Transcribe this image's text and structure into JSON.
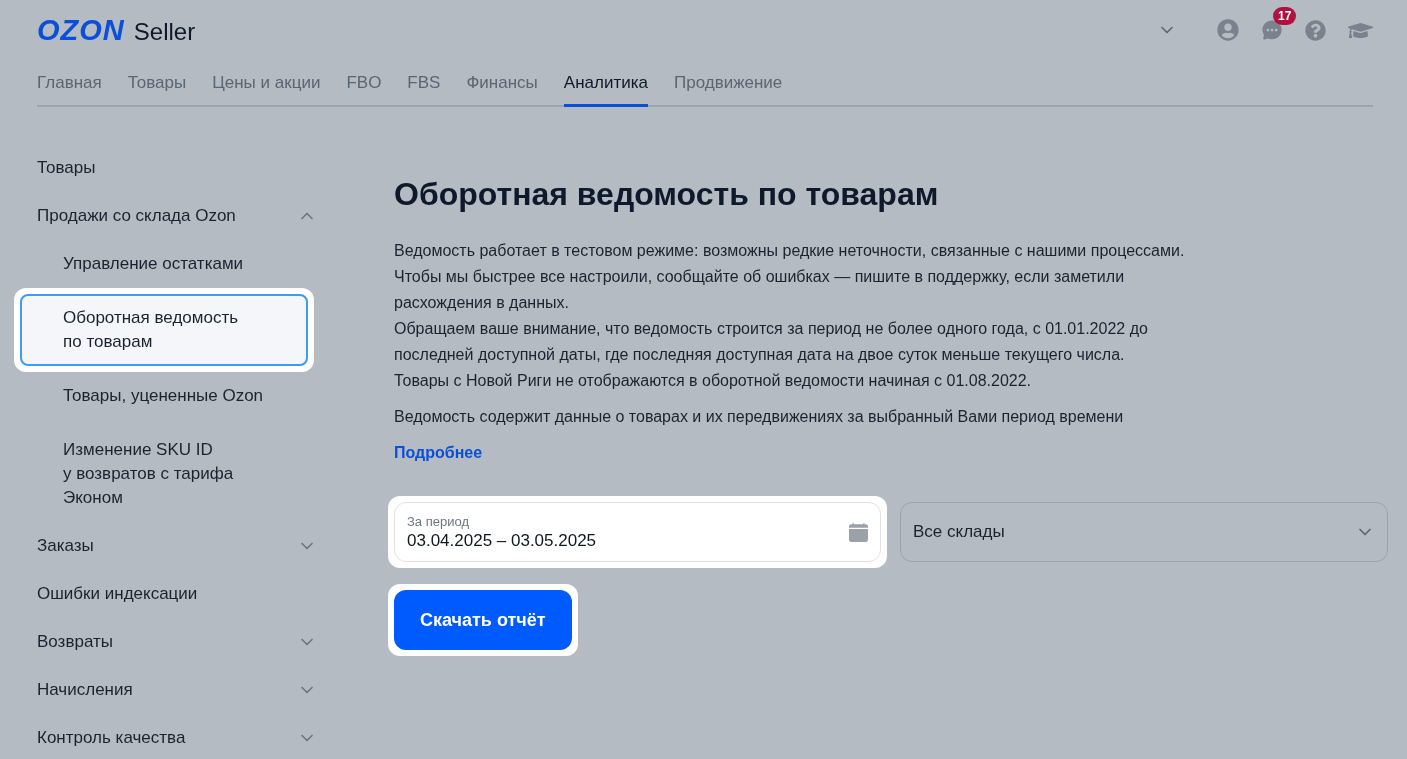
{
  "header": {
    "logo": "OZON",
    "logo_suffix": "Seller",
    "notifications": "17"
  },
  "tabs": [
    {
      "label": "Главная",
      "selected": false
    },
    {
      "label": "Товары",
      "selected": false
    },
    {
      "label": "Цены и акции",
      "selected": false
    },
    {
      "label": "FBO",
      "selected": false
    },
    {
      "label": "FBS",
      "selected": false
    },
    {
      "label": "Финансы",
      "selected": false
    },
    {
      "label": "Аналитика",
      "selected": true
    },
    {
      "label": "Продвижение",
      "selected": false
    }
  ],
  "sidebar": {
    "items": [
      {
        "label": "Товары"
      },
      {
        "label": "Продажи со склада Ozon",
        "expanded": true,
        "children": [
          {
            "label": "Управление остатками",
            "selected": false,
            "highlighted": false
          },
          {
            "label": "Оборотная ведомость\nпо товарам",
            "selected": true,
            "highlighted": true
          },
          {
            "label": "Товары, уцененные Ozon",
            "selected": false,
            "highlighted": false
          },
          {
            "label": "Изменение SKU ID\nу возвратов с тарифа\nЭконом",
            "selected": false,
            "highlighted": false
          }
        ]
      },
      {
        "label": "Заказы",
        "expanded": false
      },
      {
        "label": "Ошибки индексации"
      },
      {
        "label": "Возвраты",
        "expanded": false
      },
      {
        "label": "Начисления",
        "expanded": false
      },
      {
        "label": "Контроль качества",
        "expanded": false
      }
    ]
  },
  "main": {
    "title": "Оборотная ведомость по товарам",
    "notice_lines": [
      "Ведомость работает в тестовом режиме: возможны редкие неточности, связанные с нашими процессами. Чтобы мы быстрее все настроили, сообщайте об ошибках — пишите в поддержку, если заметили расхождения в данных.",
      "Обращаем ваше внимание, что ведомость строится за период не более одного года, с 01.01.2022 до последней доступной даты, где последняя доступная дата на двое суток меньше текущего числа.",
      "Товары с Новой Риги не отображаются в оборотной ведомости начиная с 01.08.2022."
    ],
    "description": "Ведомость содержит данные о товарах и их передвижениях за выбранный Вами период времени",
    "more_link": "Подробнее",
    "period_field": {
      "label": "За период",
      "value": "03.04.2025 – 03.05.2025",
      "highlighted": true
    },
    "warehouse_select": {
      "value": "Все склады"
    },
    "download_button": {
      "label": "Скачать отчёт",
      "highlighted": true
    }
  }
}
